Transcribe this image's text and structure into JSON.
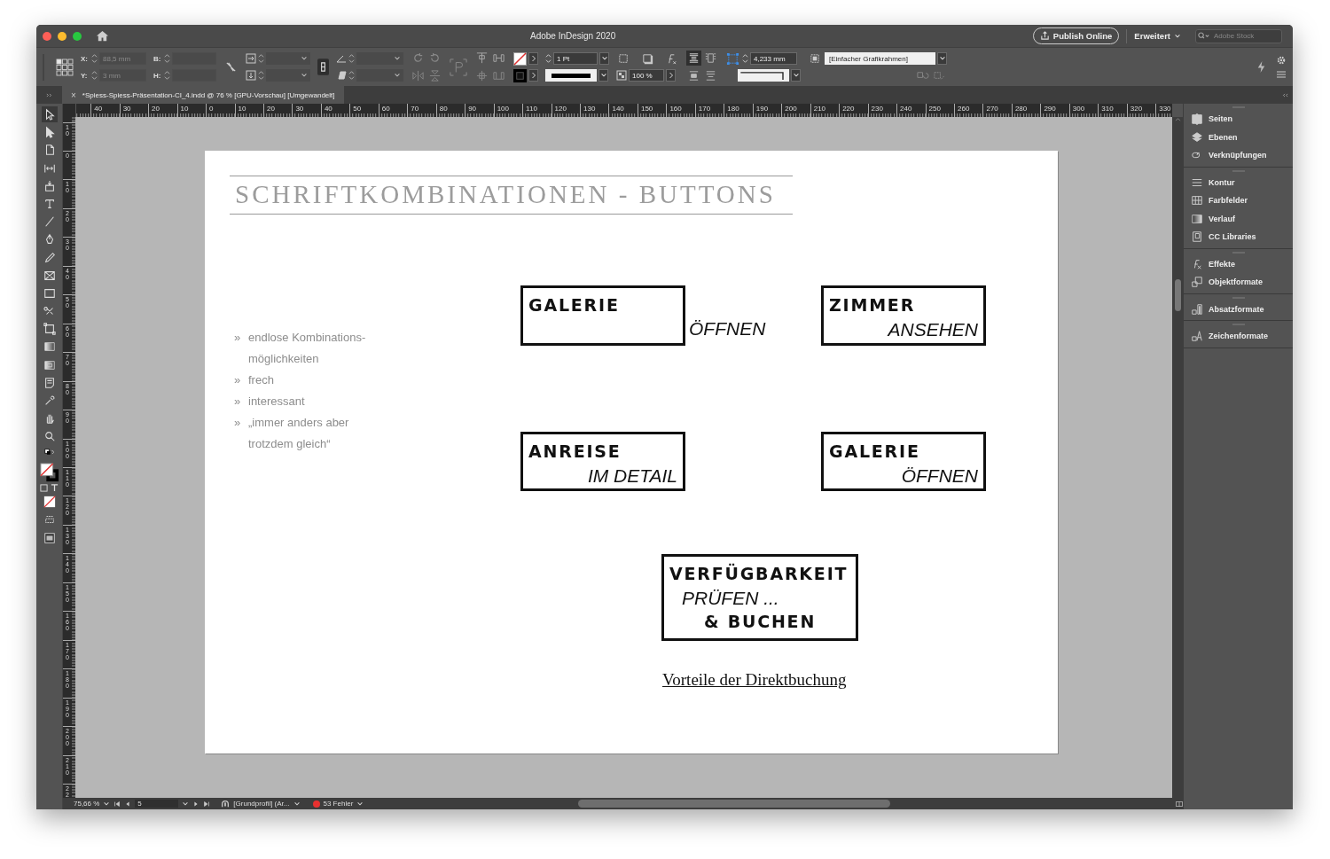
{
  "window": {
    "title": "Adobe InDesign 2020"
  },
  "header": {
    "publish_button": "Publish Online",
    "workspace_menu": "Erweitert",
    "search": {
      "placeholder": "Adobe Stock"
    }
  },
  "control_bar": {
    "x_label": "X:",
    "x_value": "88,5 mm",
    "y_label": "Y:",
    "y_value": "3 mm",
    "position_disabled": true,
    "w_label": "B:",
    "h_label": "H:",
    "stroke_weight": "1 Pt",
    "opacity": "100 %",
    "fitting_offset": "4,233 mm",
    "object_style": "[Einfacher Grafikrahmen]"
  },
  "document_tab": {
    "close": "×",
    "title": "*Spiess-Spiess-Präsentation-CI_4.indd @ 76 % [GPU-Vorschau] [Umgewandelt]"
  },
  "rulers": {
    "horizontal": [
      "40",
      "30",
      "20",
      "10",
      "0",
      "10",
      "20",
      "30",
      "40",
      "50",
      "60",
      "70",
      "80",
      "90",
      "100",
      "110",
      "120",
      "130",
      "140",
      "150",
      "160",
      "170",
      "180",
      "190",
      "200",
      "210",
      "220",
      "230",
      "240",
      "250",
      "260",
      "270",
      "280",
      "290",
      "300",
      "310",
      "320",
      "330"
    ],
    "vertical": [
      "10",
      "0",
      "10",
      "20",
      "30",
      "40",
      "50",
      "60",
      "70",
      "80",
      "90",
      "100",
      "110",
      "120",
      "130",
      "140",
      "150",
      "160",
      "170",
      "180",
      "190",
      "200",
      "210",
      "22"
    ]
  },
  "page": {
    "heading": "SCHRIFTKOMBINATIONEN - BUTTONS",
    "bullets": [
      {
        "marker": "»",
        "text": "endlose Kombinations-möglichkeiten"
      },
      {
        "marker": "»",
        "text": "frech"
      },
      {
        "marker": "»",
        "text": "interessant"
      },
      {
        "marker": "»",
        "text": "„immer anders aber trotzdem gleich“"
      }
    ],
    "buttons": [
      {
        "lines": [
          {
            "text": "GALERIE",
            "kind": "bold"
          }
        ],
        "outside_text": "ÖFFNEN"
      },
      {
        "lines": [
          {
            "text": "ZIMMER",
            "kind": "bold"
          },
          {
            "text": "ANSEHEN",
            "kind": "italic"
          }
        ]
      },
      {
        "lines": [
          {
            "text": "ANREISE",
            "kind": "bold"
          },
          {
            "text": "IM DETAIL",
            "kind": "italic"
          }
        ]
      },
      {
        "lines": [
          {
            "text": "GALERIE",
            "kind": "bold"
          },
          {
            "text": "ÖFFNEN",
            "kind": "italic"
          }
        ]
      },
      {
        "lines": [
          {
            "text": "VERFÜGBARKEIT",
            "kind": "bold"
          },
          {
            "text": "PRÜFEN ...",
            "kind": "italic"
          },
          {
            "text": "& BUCHEN",
            "kind": "bold"
          }
        ]
      }
    ],
    "link": "Vorteile der Direktbuchung"
  },
  "panels": [
    [
      {
        "label": "Seiten",
        "kind": "pages"
      },
      {
        "label": "Ebenen",
        "kind": "layers"
      },
      {
        "label": "Verknüpfungen",
        "kind": "links"
      }
    ],
    [
      {
        "label": "Kontur",
        "kind": "stroke"
      },
      {
        "label": "Farbfelder",
        "kind": "swatches"
      },
      {
        "label": "Verlauf",
        "kind": "gradient"
      },
      {
        "label": "CC Libraries",
        "kind": "libraries"
      }
    ],
    [
      {
        "label": "Effekte",
        "kind": "effects"
      },
      {
        "label": "Objektformate",
        "kind": "objectstyles"
      }
    ],
    [
      {
        "label": "Absatzformate",
        "kind": "parastyles"
      }
    ],
    [
      {
        "label": "Zeichenformate",
        "kind": "charstyles"
      }
    ]
  ],
  "status_bar": {
    "zoom": "75,66 %",
    "page": "5",
    "profile": "[Grundprofil] (Ar...",
    "errors": "53 Fehler"
  }
}
